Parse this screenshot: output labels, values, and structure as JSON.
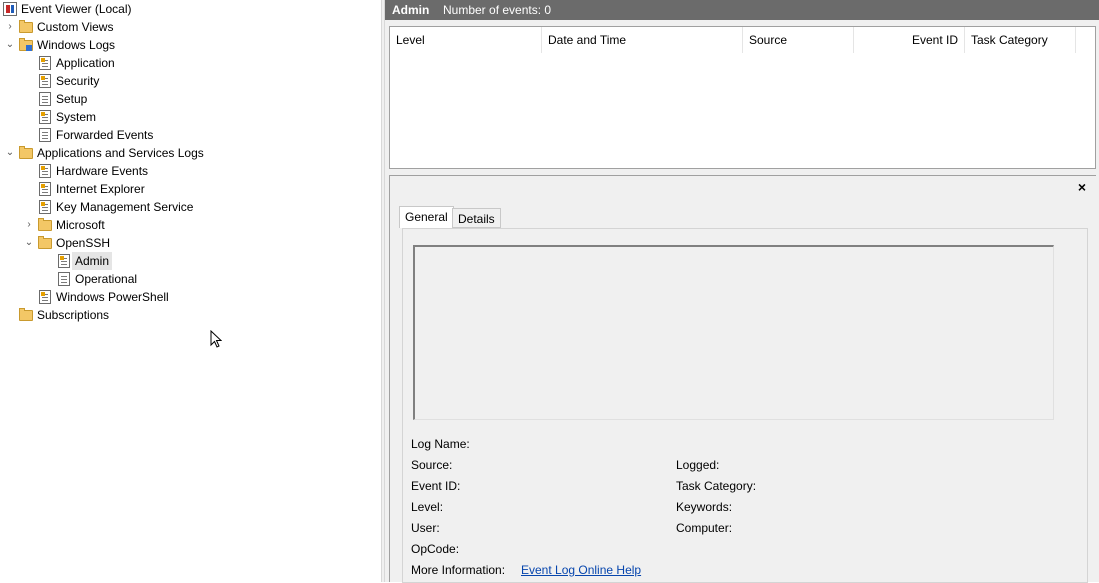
{
  "tree": {
    "root": "Event Viewer (Local)",
    "custom_views": "Custom Views",
    "windows_logs": "Windows Logs",
    "application": "Application",
    "security": "Security",
    "setup": "Setup",
    "system": "System",
    "forwarded_events": "Forwarded Events",
    "apps_services": "Applications and Services Logs",
    "hardware_events": "Hardware Events",
    "internet_explorer": "Internet Explorer",
    "key_management": "Key Management Service",
    "microsoft": "Microsoft",
    "openssh": "OpenSSH",
    "admin": "Admin",
    "operational": "Operational",
    "powershell": "Windows PowerShell",
    "subscriptions": "Subscriptions"
  },
  "header": {
    "title": "Admin",
    "count": "Number of events: 0"
  },
  "grid": {
    "columns": [
      "Level",
      "Date and Time",
      "Source",
      "Event ID",
      "Task Category"
    ]
  },
  "detail": {
    "close": "×",
    "tabs": [
      "General",
      "Details"
    ],
    "fields": {
      "log_name": "Log Name:",
      "source": "Source:",
      "logged": "Logged:",
      "event_id": "Event ID:",
      "task_category": "Task Category:",
      "level": "Level:",
      "keywords": "Keywords:",
      "user": "User:",
      "computer": "Computer:",
      "opcode": "OpCode:",
      "more_info": "More Information:",
      "help_link": "Event Log Online Help"
    }
  }
}
